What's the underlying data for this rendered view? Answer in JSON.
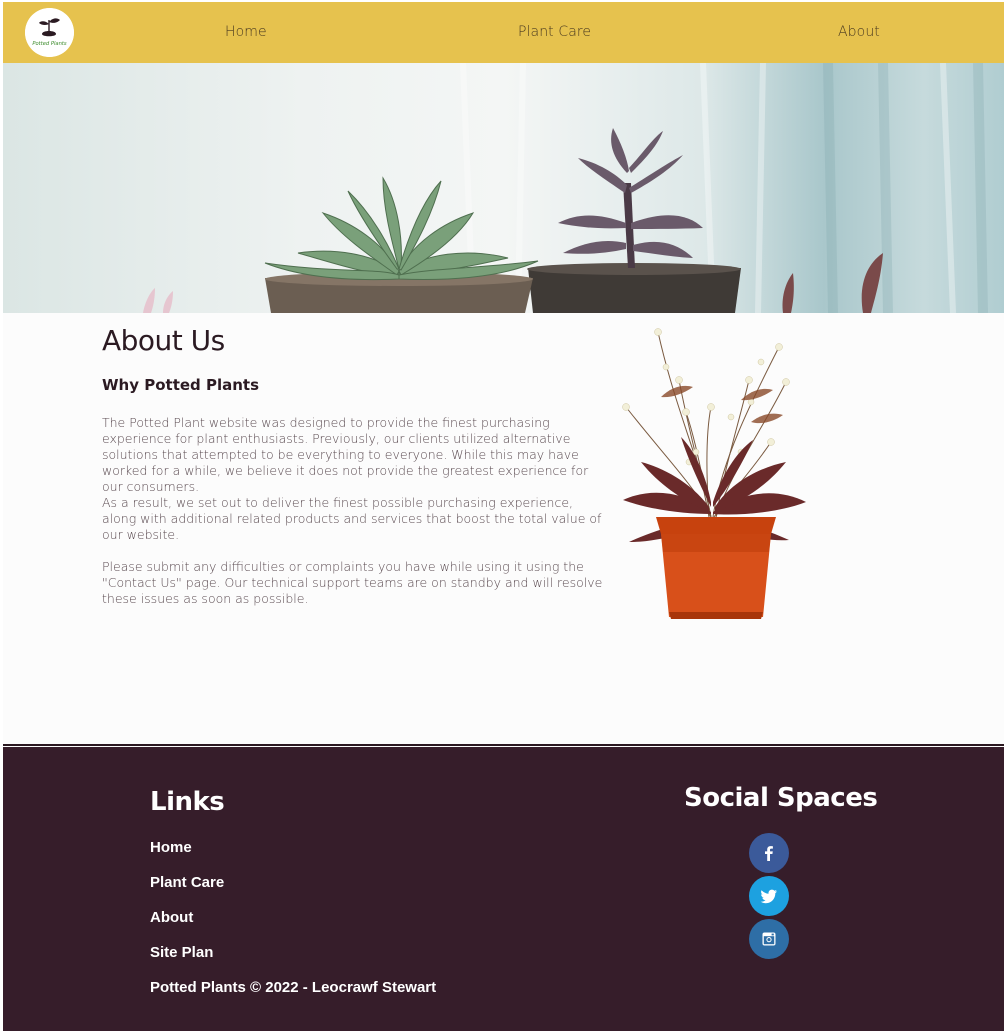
{
  "nav": {
    "logo_text": "Potted Plants",
    "items": [
      {
        "label": "Home"
      },
      {
        "label": "Plant Care"
      },
      {
        "label": "About"
      }
    ]
  },
  "main": {
    "title": "About Us",
    "subtitle": "Why Potted Plants",
    "paragraphs": [
      "The Potted Plant website was designed to provide the finest purchasing experience for plant enthusiasts. Previously, our clients utilized alternative solutions that attempted to be everything to everyone. While this may have worked for a while, we believe it does not provide the greatest experience for our consumers.",
      "As a result, we set out to deliver the finest possible purchasing experience, along with additional related products and services that boost the total value of our website.",
      "Please submit any difficulties or complaints you have while using it using the \"Contact Us\" page. Our technical support teams are on standby and will resolve these issues as soon as possible."
    ]
  },
  "footer": {
    "links_title": "Links",
    "links": [
      {
        "label": "Home"
      },
      {
        "label": "Plant Care"
      },
      {
        "label": "About"
      },
      {
        "label": "Site Plan"
      }
    ],
    "copyright": "Potted Plants © 2022 - Leocrawf Stewart",
    "social_title": "Social Spaces",
    "social": [
      {
        "icon": "facebook-icon",
        "color": "#3b5a9a"
      },
      {
        "icon": "twitter-icon",
        "color": "#1da1e0"
      },
      {
        "icon": "instagram-icon",
        "color": "#2e6ea6"
      }
    ]
  },
  "colors": {
    "navbar": "#e6c24e",
    "footer": "#361d2a",
    "page": "#fcfcfc"
  }
}
